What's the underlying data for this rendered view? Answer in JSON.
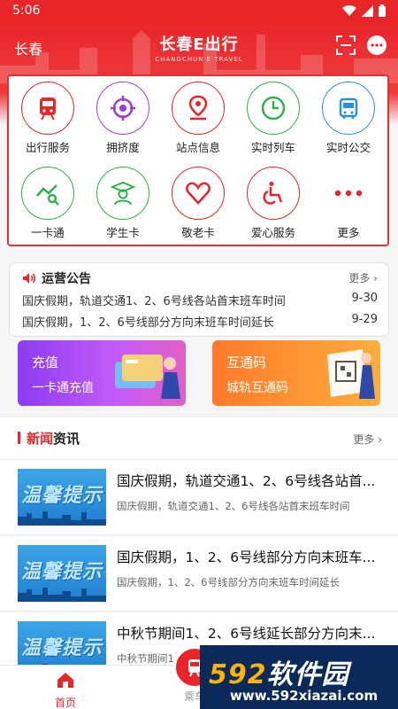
{
  "status_bar": {
    "time": "5:06"
  },
  "header": {
    "city": "长春",
    "logo_cn": "长春E出行",
    "logo_en": "CHANGCHUN E TRAVEL"
  },
  "services": [
    {
      "label": "出行服务",
      "icon": "train-icon",
      "color": "#e8262a"
    },
    {
      "label": "拥挤度",
      "icon": "target-icon",
      "color": "#9b3fd4"
    },
    {
      "label": "站点信息",
      "icon": "location-pin-icon",
      "color": "#e8262a"
    },
    {
      "label": "实时列车",
      "icon": "clock-icon",
      "color": "#2fb24a"
    },
    {
      "label": "实时公交",
      "icon": "bus-icon",
      "color": "#2b8fe0"
    },
    {
      "label": "一卡通",
      "icon": "card-search-icon",
      "color": "#2fb24a"
    },
    {
      "label": "学生卡",
      "icon": "student-icon",
      "color": "#2fb24a"
    },
    {
      "label": "敬老卡",
      "icon": "heart-icon",
      "color": "#e8262a"
    },
    {
      "label": "爱心服务",
      "icon": "accessibility-icon",
      "color": "#e8262a"
    },
    {
      "label": "更多",
      "icon": "more-dots-icon",
      "color": "#e8262a"
    }
  ],
  "notice": {
    "title": "运营公告",
    "more": "更多",
    "items": [
      {
        "text": "国庆假期，轨道交通1、2、6号线各站首末班车时间",
        "date": "9-30"
      },
      {
        "text": "国庆假期，1、2、6号线部分方向末班车时间延长",
        "date": "9-29"
      }
    ]
  },
  "promos": [
    {
      "title": "充值",
      "subtitle": "一卡通充值"
    },
    {
      "title": "互通码",
      "subtitle": "城轨互通码"
    }
  ],
  "news": {
    "title_red": "新闻",
    "title_rest": "资讯",
    "more": "更多",
    "thumb_text": "温馨提示",
    "items": [
      {
        "headline": "国庆假期，轨道交通1、2、6号线各站首...",
        "sub": "国庆假期，轨道交通1、2、6号线各站首末班车时间"
      },
      {
        "headline": "国庆假期，1、2、6号线部分方向末班车...",
        "sub": "国庆假期，1、2、6号线部分方向末班车时间延长"
      },
      {
        "headline": "中秋节期间1、2、6号线延长部分方向末...",
        "sub": "中秋节期间1"
      }
    ]
  },
  "tabbar": {
    "home": "首页",
    "ride": "乘车"
  },
  "watermark": {
    "main_num": "592",
    "main_cn": "软件园",
    "url": "www.592xiazai.com"
  }
}
